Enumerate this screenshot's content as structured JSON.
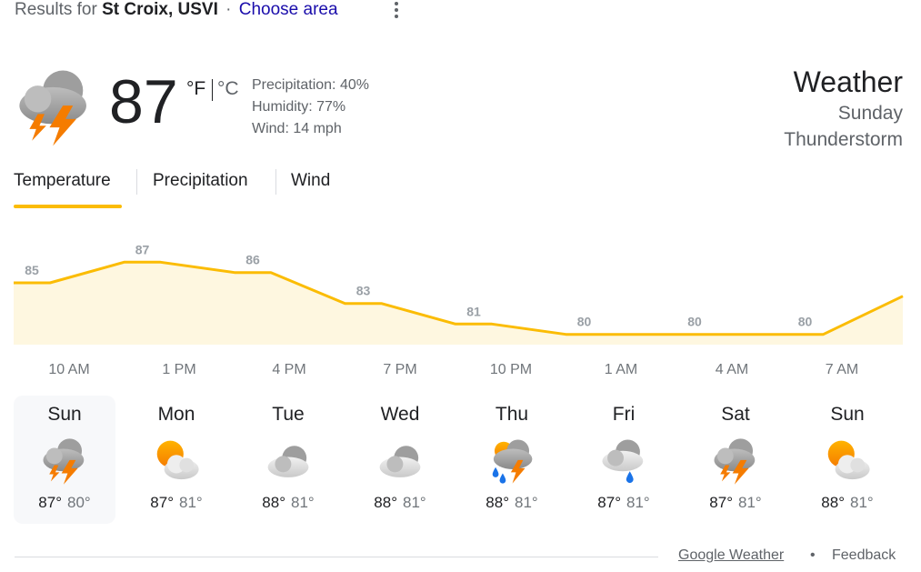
{
  "header": {
    "results_prefix": "Results for",
    "place": "St Croix, USVI",
    "separator": "·",
    "choose_area": "Choose area"
  },
  "current": {
    "icon": "thunderstorm-icon",
    "temp": "87",
    "unit_f": "°F",
    "unit_c": "°C",
    "precipitation": "Precipitation: 40%",
    "humidity": "Humidity: 77%",
    "wind": "Wind: 14 mph",
    "title": "Weather",
    "day": "Sunday",
    "condition": "Thunderstorm"
  },
  "tabs": [
    {
      "label": "Temperature",
      "selected": true
    },
    {
      "label": "Precipitation",
      "selected": false
    },
    {
      "label": "Wind",
      "selected": false
    }
  ],
  "chart_data": {
    "type": "area",
    "x": [
      "10 AM",
      "1 PM",
      "4 PM",
      "7 PM",
      "10 PM",
      "1 AM",
      "4 AM",
      "7 AM"
    ],
    "values": [
      85,
      87,
      86,
      83,
      81,
      80,
      80,
      80
    ],
    "labels": [
      "85",
      "87",
      "86",
      "83",
      "81",
      "80",
      "80",
      "80"
    ],
    "line_color": "#fbbc04",
    "fill_color": "#fef7e0",
    "label_color": "#9aa0a6"
  },
  "forecast": [
    {
      "day": "Sun",
      "icon": "thunderstorm-icon",
      "hi": "87°",
      "lo": "80°",
      "selected": true
    },
    {
      "day": "Mon",
      "icon": "partly-cloudy-icon",
      "hi": "87°",
      "lo": "81°",
      "selected": false
    },
    {
      "day": "Tue",
      "icon": "cloudy-icon",
      "hi": "88°",
      "lo": "81°",
      "selected": false
    },
    {
      "day": "Wed",
      "icon": "cloudy-icon",
      "hi": "88°",
      "lo": "81°",
      "selected": false
    },
    {
      "day": "Thu",
      "icon": "storm-rain-icon",
      "hi": "88°",
      "lo": "81°",
      "selected": false
    },
    {
      "day": "Fri",
      "icon": "rain-icon",
      "hi": "87°",
      "lo": "81°",
      "selected": false
    },
    {
      "day": "Sat",
      "icon": "thunderstorm-icon",
      "hi": "87°",
      "lo": "81°",
      "selected": false
    },
    {
      "day": "Sun",
      "icon": "partly-cloudy-icon",
      "hi": "88°",
      "lo": "81°",
      "selected": false
    }
  ],
  "footer": {
    "source": "Google Weather",
    "dot": "•",
    "feedback": "Feedback"
  }
}
